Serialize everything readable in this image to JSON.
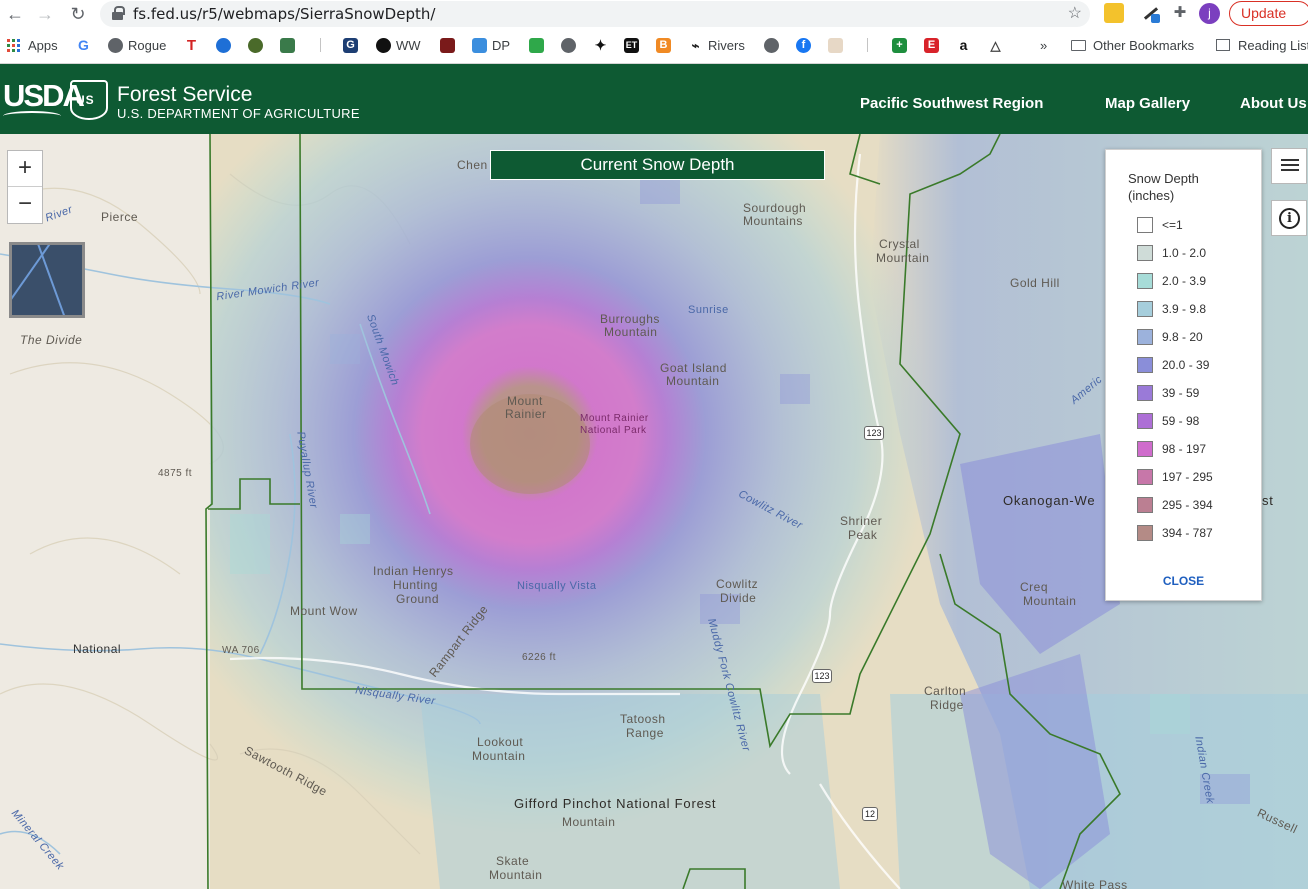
{
  "browser": {
    "url": "fs.fed.us/r5/webmaps/SierraSnowDepth/",
    "profile_initial": "j",
    "update_label": "Update",
    "bookmarks": [
      {
        "label": "Apps"
      },
      {
        "label": "Rogue"
      },
      {
        "label": "WW"
      },
      {
        "label": "DP"
      },
      {
        "label": "Rivers"
      }
    ],
    "more_label": "»",
    "other_bookmarks": "Other Bookmarks",
    "reading_list": "Reading List"
  },
  "header": {
    "usda": "USDA",
    "title": "Forest Service",
    "subtitle": "U.S. DEPARTMENT OF AGRICULTURE",
    "nav": [
      "Pacific Southwest Region",
      "Map Gallery",
      "About Us"
    ]
  },
  "map": {
    "title": "Current Snow Depth",
    "zoom_in": "+",
    "zoom_out": "−",
    "places": {
      "pierce": "Pierce",
      "divide": "The Divide",
      "mowich": "River Mowich River",
      "south_mowich": "South Mowich",
      "cheney": "Chen",
      "sourdough": "Sourdough",
      "sourdough2": "Mountains",
      "crystal": "Crystal",
      "crystal2": "Mountain",
      "gold_hill": "Gold Hill",
      "burroughs": "Burroughs",
      "burroughs2": "Mountain",
      "sunrise": "Sunrise",
      "goat_island": "Goat Island",
      "goat_island2": "Mountain",
      "mt_rainier": "Mount",
      "mt_rainier2": "Rainier",
      "mrnp": "Mount Rainier",
      "mrnp2": "National Park",
      "elev_4875": "4875 ft",
      "puyallup": "Puyallup River",
      "shriner": "Shriner",
      "shriner2": "Peak",
      "okanogan": "Okanogan-We",
      "okanogan_end": "st",
      "america": "Americ",
      "indian_henrys": "Indian Henrys",
      "hunting": "Hunting",
      "ground": "Ground",
      "nisqually_vista": "Nisqually Vista",
      "cowlitz": "Cowlitz",
      "cowlitz2": "Divide",
      "cowlitz_river": "Cowlitz River",
      "mount_wow": "Mount Wow",
      "rampart": "Rampart Ridge",
      "creq": "Creq",
      "creq2": "Mountain",
      "national": "National",
      "wa706": "WA 706",
      "nisqually_river": "Nisqually River",
      "muddy_fork": "Muddy Fork Cowlitz River",
      "elev_6226": "6226 ft",
      "carlton": "Carlton",
      "carlton2": "Ridge",
      "tatoosh": "Tatoosh",
      "tatoosh2": "Range",
      "lookout": "Lookout",
      "lookout2": "Mountain",
      "sawtooth": "Sawtooth Ridge",
      "gifford": "Gifford Pinchot National Forest",
      "gp_mountain": "Mountain",
      "skate": "Skate",
      "skate2": "Mountain",
      "mineral": "Mineral Creek",
      "indian_creek": "Indian Creek",
      "russell": "Russell",
      "white_pass": "White Pass",
      "river_label": "River"
    },
    "routes": {
      "r123a": "123",
      "r123b": "123",
      "r12": "12"
    }
  },
  "legend": {
    "title_line1": "Snow Depth",
    "title_line2": "(inches)",
    "close": "CLOSE",
    "items": [
      {
        "label": "<=1",
        "color": "#ffffff"
      },
      {
        "label": "1.0 - 2.0",
        "color": "#cfdcd8"
      },
      {
        "label": "2.0 - 3.9",
        "color": "#a7dcd8"
      },
      {
        "label": "3.9 - 9.8",
        "color": "#a6cedc"
      },
      {
        "label": "9.8 - 20",
        "color": "#9cb2dc"
      },
      {
        "label": "20.0 - 39",
        "color": "#8a8ed9"
      },
      {
        "label": "39 - 59",
        "color": "#9a7ad8"
      },
      {
        "label": "59 - 98",
        "color": "#ad6fd6"
      },
      {
        "label": "98 - 197",
        "color": "#cf6ccc"
      },
      {
        "label": "197 - 295",
        "color": "#c777a9"
      },
      {
        "label": "295 - 394",
        "color": "#bb7f92"
      },
      {
        "label": "394 - 787",
        "color": "#b48b86"
      }
    ]
  }
}
